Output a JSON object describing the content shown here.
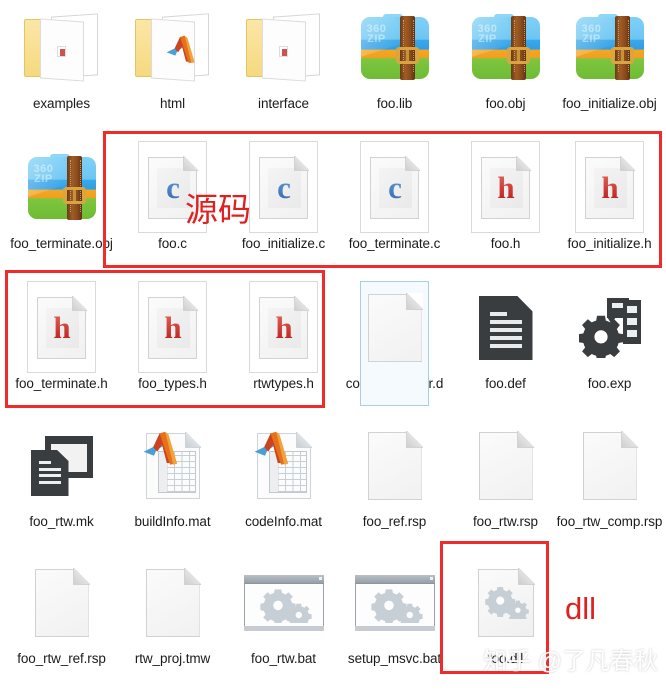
{
  "window": {
    "view": "large-icons",
    "background_color": "#ffffff"
  },
  "annotations": {
    "source_code_label": "源码",
    "dll_label": "dll",
    "highlight_color": "#ef2b2b",
    "label_color": "#e02020"
  },
  "watermark": {
    "site": "知乎",
    "handle": "@了凡春秋"
  },
  "rows": [
    {
      "index": 0,
      "items": [
        {
          "name": "examples",
          "icon": "folder-icon",
          "selected": false
        },
        {
          "name": "html",
          "icon": "folder-matlab-icon",
          "selected": false
        },
        {
          "name": "interface",
          "icon": "folder-icon",
          "selected": false
        },
        {
          "name": "foo.lib",
          "icon": "archive-360zip-icon",
          "selected": false
        },
        {
          "name": "foo.obj",
          "icon": "archive-360zip-icon",
          "selected": false
        },
        {
          "name": "foo_initialize.obj",
          "icon": "archive-360zip-icon",
          "selected": false
        }
      ]
    },
    {
      "index": 1,
      "items": [
        {
          "name": "foo_terminate.obj",
          "icon": "archive-360zip-icon",
          "selected": false
        },
        {
          "name": "foo.c",
          "icon": "c-source-icon",
          "selected": true
        },
        {
          "name": "foo_initialize.c",
          "icon": "c-source-icon",
          "selected": true
        },
        {
          "name": "foo_terminate.c",
          "icon": "c-source-icon",
          "selected": true
        },
        {
          "name": "foo.h",
          "icon": "h-header-icon",
          "selected": true
        },
        {
          "name": "foo_initialize.h",
          "icon": "h-header-icon",
          "selected": true
        }
      ]
    },
    {
      "index": 2,
      "items": [
        {
          "name": "foo_terminate.h",
          "icon": "h-header-icon",
          "selected": true
        },
        {
          "name": "foo_types.h",
          "icon": "h-header-icon",
          "selected": true
        },
        {
          "name": "rtwtypes.h",
          "icon": "h-header-icon",
          "selected": true
        },
        {
          "name": "codedescriptor.dmr",
          "icon": "blank-page-icon",
          "selected": "hover"
        },
        {
          "name": "foo.def",
          "icon": "dark-document-icon",
          "selected": false
        },
        {
          "name": "foo.exp",
          "icon": "gear-export-icon",
          "selected": false
        }
      ]
    },
    {
      "index": 3,
      "items": [
        {
          "name": "foo_rtw.mk",
          "icon": "makefile-icon",
          "selected": false
        },
        {
          "name": "buildInfo.mat",
          "icon": "matlab-mat-icon",
          "selected": false
        },
        {
          "name": "codeInfo.mat",
          "icon": "matlab-mat-icon",
          "selected": false
        },
        {
          "name": "foo_ref.rsp",
          "icon": "blank-page-icon",
          "selected": false
        },
        {
          "name": "foo_rtw.rsp",
          "icon": "blank-page-icon",
          "selected": false
        },
        {
          "name": "foo_rtw_comp.rsp",
          "icon": "blank-page-icon",
          "selected": false
        }
      ]
    },
    {
      "index": 4,
      "items": [
        {
          "name": "foo_rtw_ref.rsp",
          "icon": "blank-page-icon",
          "selected": false
        },
        {
          "name": "rtw_proj.tmw",
          "icon": "blank-page-icon",
          "selected": false
        },
        {
          "name": "foo_rtw.bat",
          "icon": "batch-script-icon",
          "selected": false
        },
        {
          "name": "setup_msvc.bat",
          "icon": "batch-script-icon",
          "selected": false
        },
        {
          "name": "foo.dll",
          "icon": "dll-gears-icon",
          "selected": false
        },
        {
          "name": "",
          "icon": "none",
          "selected": false
        }
      ]
    }
  ]
}
